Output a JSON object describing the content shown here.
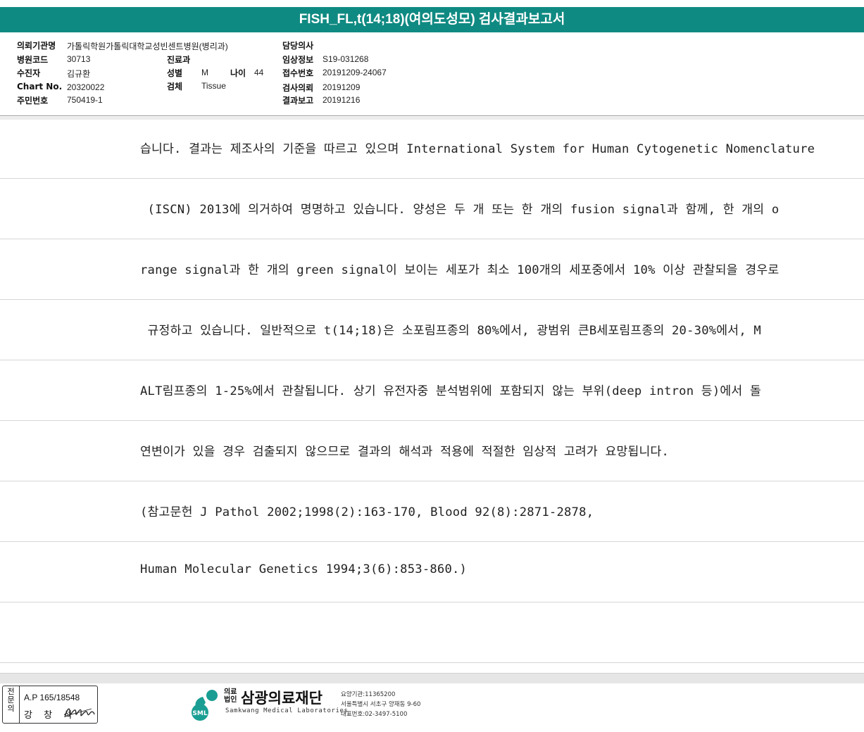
{
  "title": "FISH_FL,t(14;18)(여의도성모) 검사결과보고서",
  "info": {
    "institution_label": "의뢰기관명",
    "institution_value": "가톨릭학원가톨릭대학교성빈센트병원(병리과)",
    "hospital_code_label": "병원코드",
    "hospital_code_value": "30713",
    "patient_label": "수진자",
    "patient_value": "김규환",
    "chart_label": "Chart No.",
    "chart_value": "20320022",
    "resident_label": "주민번호",
    "resident_value": "750419-1",
    "dept_label": "진료과",
    "dept_value": "",
    "sex_label": "성별",
    "sex_value": "M",
    "age_label": "나이",
    "age_value": "44",
    "specimen_label": "검체",
    "specimen_value": "Tissue",
    "doctor_label": "담당의사",
    "doctor_value": "",
    "clinical_label": "임상정보",
    "clinical_value": "S19-031268",
    "receipt_label": "접수번호",
    "receipt_value": "20191209-24067",
    "request_label": "검사의뢰",
    "request_value": "20191209",
    "report_label": "결과보고",
    "report_value": "20191216"
  },
  "body_lines": [
    "습니다. 결과는 제조사의 기준을 따르고 있으며 International System for Human Cytogenetic Nomenclature",
    " (ISCN) 2013에 의거하여 명명하고 있습니다. 양성은 두 개 또는 한 개의 fusion signal과 함께, 한 개의 o",
    "range signal과 한 개의 green signal이 보이는 세포가 최소 100개의 세포중에서 10% 이상 관찰되을 경우로",
    " 규정하고 있습니다. 일반적으로 t(14;18)은 소포림프종의 80%에서, 광범위 큰B세포림프종의 20-30%에서, M",
    "ALT림프종의 1-25%에서 관찰됩니다. 상기 유전자중 분석범위에 포함되지 않는 부위(deep intron 등)에서 돌",
    "연변이가 있을 경우 검출되지 않으므로 결과의 해석과 적용에 적절한 임상적 고려가 요망됩니다.",
    "(참고문헌 J Pathol 2002;1998(2):163-170, Blood 92(8):2871-2878,",
    "Human Molecular Genetics 1994;3(6):853-860.)",
    ""
  ],
  "signature": {
    "side_chars": [
      "전",
      "문",
      "의"
    ],
    "ap": "A.P 165/18548",
    "name": "강 창 석"
  },
  "logo": {
    "icon_text": "SML",
    "prefix_1": "의료",
    "prefix_2": "법인",
    "name": "삼광의료재단",
    "english": "Samkwang Medical Laboratories",
    "contact_1": "요양기관:11365200",
    "contact_2": "서울특별시 서초구 양재동 9-60",
    "contact_3": "대표번호:02-3497-5100"
  },
  "colors": {
    "title_bg": "#0f8a82",
    "logo_teal": "#1a9e93"
  }
}
